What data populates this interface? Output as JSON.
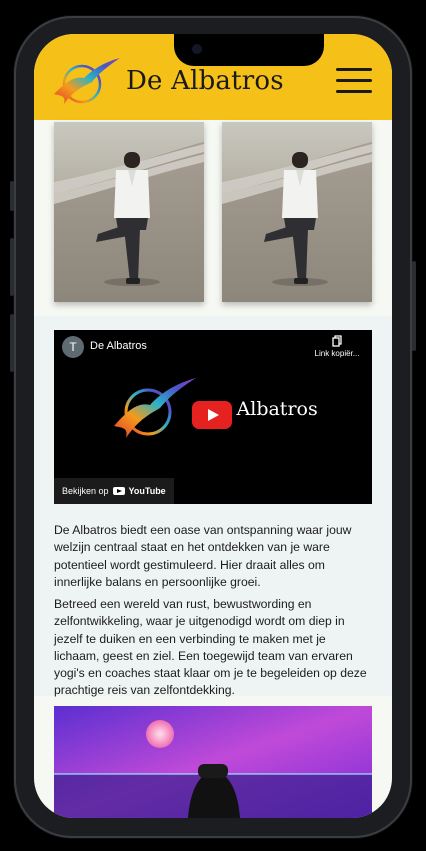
{
  "header": {
    "brand": "De Albatros",
    "menu_icon": "hamburger-menu-icon",
    "background": "#f5c118"
  },
  "gallery": {
    "images": [
      "yoga-tree-pose-photo",
      "yoga-tree-pose-photo"
    ]
  },
  "video": {
    "channel_initial": "T",
    "channel_name": "De Albatros",
    "copy_link_label": "Link kopiër...",
    "title": "De Albatros",
    "watch_on_label": "Bekijken op",
    "platform_label": "YouTube",
    "play_color": "#e5221f"
  },
  "about": {
    "paragraph_1": "De Albatros biedt een oase van ontspanning waar jouw welzijn centraal staat en het ontdekken van je ware potentieel wordt gestimuleerd. Hier draait alles om innerlijke balans en persoonlijke groei.",
    "paragraph_2": "Betreed een wereld van rust, bewustwording en zelfontwikkeling, waar je uitgenodigd wordt om diep in jezelf te duiken en een verbinding te maken met je lichaam, geest en ziel. Een toegewijd team van ervaren yogi's en coaches staat klaar om je te begeleiden op deze prachtige reis van zelfontdekking."
  }
}
